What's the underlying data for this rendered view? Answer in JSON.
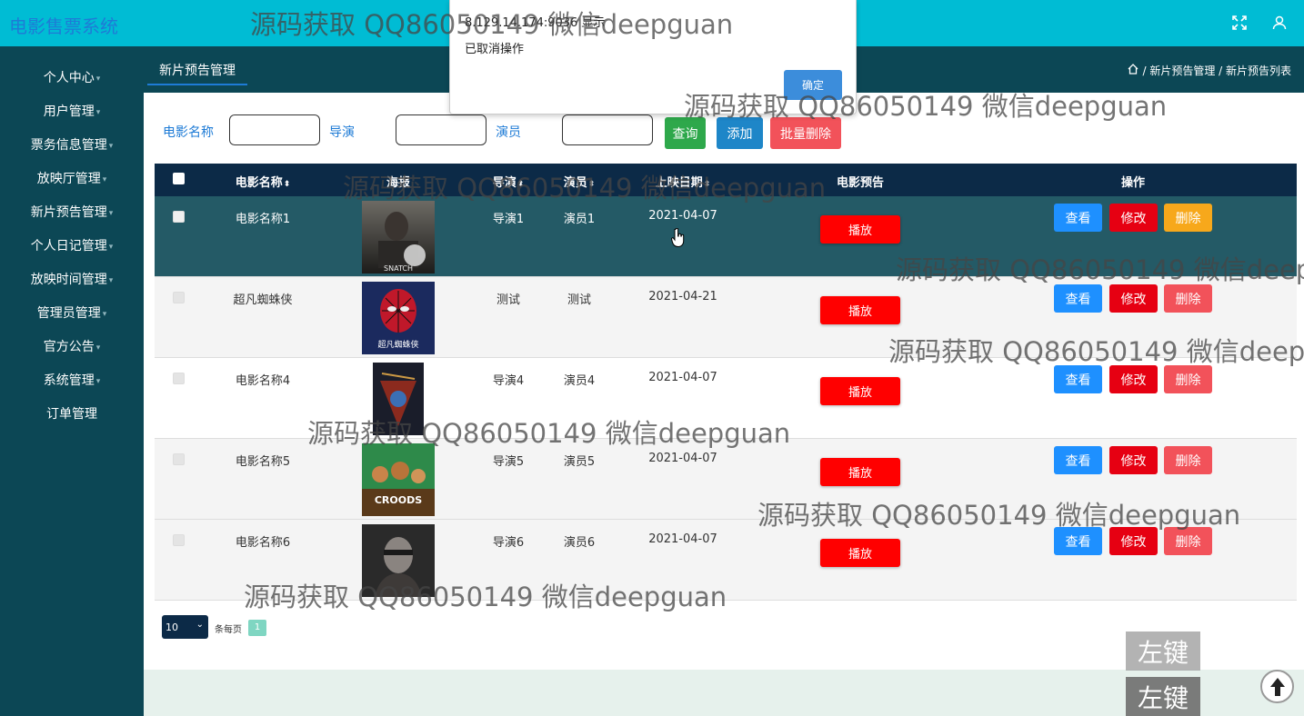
{
  "app": {
    "title": "电影售票系统"
  },
  "sidebar": {
    "items": [
      {
        "label": "个人中心"
      },
      {
        "label": "用户管理"
      },
      {
        "label": "票务信息管理"
      },
      {
        "label": "放映厅管理"
      },
      {
        "label": "新片预告管理"
      },
      {
        "label": "个人日记管理"
      },
      {
        "label": "放映时间管理"
      },
      {
        "label": "管理员管理"
      },
      {
        "label": "官方公告"
      },
      {
        "label": "系统管理"
      },
      {
        "label": "订单管理"
      }
    ]
  },
  "tab": {
    "label": "新片预告管理"
  },
  "breadcrumb": {
    "parts": [
      "/ 新片预告管理 / 新片预告列表"
    ]
  },
  "search": {
    "movie_label": "电影名称",
    "director_label": "导演",
    "actor_label": "演员",
    "query_btn": "查询",
    "add_btn": "添加",
    "batch_delete_btn": "批量删除"
  },
  "table": {
    "headers": [
      "电影名称",
      "海报",
      "导演",
      "演员",
      "上映日期",
      "电影预告",
      "操作"
    ],
    "play_label": "播放",
    "actions": {
      "view": "查看",
      "edit": "修改",
      "delete": "删除"
    },
    "rows": [
      {
        "name": "电影名称1",
        "director": "导演1",
        "actor": "演员1",
        "date": "2021-04-07"
      },
      {
        "name": "超凡蜘蛛侠",
        "director": "测试",
        "actor": "测试",
        "date": "2021-04-21"
      },
      {
        "name": "电影名称4",
        "director": "导演4",
        "actor": "演员4",
        "date": "2021-04-07"
      },
      {
        "name": "电影名称5",
        "director": "导演5",
        "actor": "演员5",
        "date": "2021-04-07"
      },
      {
        "name": "电影名称6",
        "director": "导演6",
        "actor": "演员6",
        "date": "2021-04-07"
      }
    ]
  },
  "pager": {
    "page_size": "10",
    "per_page_label": "条每页",
    "current_page": "1"
  },
  "dialog": {
    "title": "8.129.14.174:9036 显示",
    "message": "已取消操作",
    "ok_label": "确定"
  },
  "watermark": {
    "text": "源码获取 QQ86050149 微信deepguan"
  },
  "overlay": {
    "key_label": "左键"
  },
  "icons": {
    "fullscreen": "expand-icon",
    "user": "user-icon",
    "home": "home-icon",
    "scroll_top": "arrow-up-icon"
  },
  "colors": {
    "topbar": "#00bcd4",
    "sidebar": "#0c4755",
    "table_header": "#0c2a47",
    "play": "#ff0000",
    "view": "#1e90ff",
    "edit": "#e60012",
    "delete": "#f2525a"
  }
}
